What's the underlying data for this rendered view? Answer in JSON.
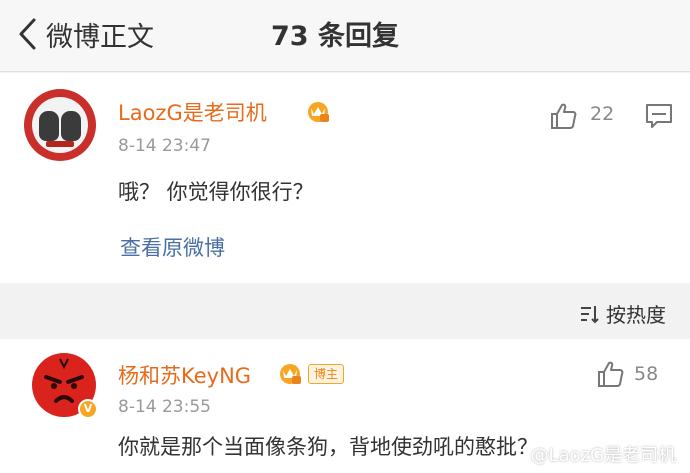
{
  "nav": {
    "back_label": "微博正文",
    "title": "73 条回复"
  },
  "comment": {
    "user_name": "LaozG是老司机",
    "time": "8-14 23:47",
    "text": "哦？ 你觉得你很行？",
    "view_original": "查看原微博",
    "like_count": "22"
  },
  "sort": {
    "label": "按热度"
  },
  "reply": {
    "user_name": "杨和苏KeyNG",
    "author_badge": "博主",
    "time": "8-14 23:55",
    "text": "你就是那个当面像条狗，背地使劲吼的憨批？",
    "like_count": "58"
  },
  "watermark": "@LaozG是老司机",
  "colors": {
    "username": "#e86b1b",
    "link": "#4a6fa5",
    "meta": "#999999"
  }
}
